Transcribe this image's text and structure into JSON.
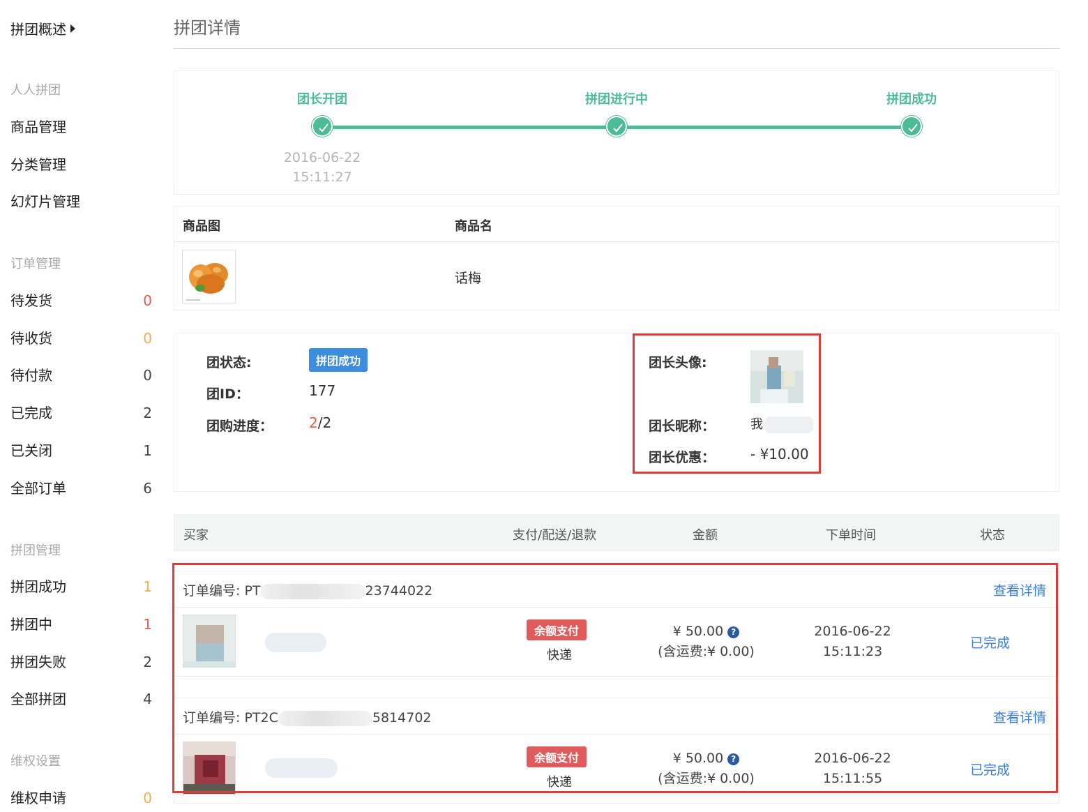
{
  "sidebar": {
    "top_link": "拼团概述",
    "sections": [
      {
        "heading": "人人拼团",
        "items": [
          {
            "label": "商品管理",
            "count": ""
          },
          {
            "label": "分类管理",
            "count": ""
          },
          {
            "label": "幻灯片管理",
            "count": ""
          }
        ]
      },
      {
        "heading": "订单管理",
        "items": [
          {
            "label": "待发货",
            "count": "0"
          },
          {
            "label": "待收货",
            "count": "0"
          },
          {
            "label": "待付款",
            "count": "0"
          },
          {
            "label": "已完成",
            "count": "2"
          },
          {
            "label": "已关闭",
            "count": "1"
          },
          {
            "label": "全部订单",
            "count": "6"
          }
        ]
      },
      {
        "heading": "拼团管理",
        "items": [
          {
            "label": "拼团成功",
            "count": "1"
          },
          {
            "label": "拼团中",
            "count": "1"
          },
          {
            "label": "拼团失败",
            "count": "2"
          },
          {
            "label": "全部拼团",
            "count": "4"
          }
        ]
      },
      {
        "heading": "维权设置",
        "items": [
          {
            "label": "维权申请",
            "count": "0"
          }
        ]
      }
    ]
  },
  "page": {
    "title": "拼团详情"
  },
  "progress": {
    "steps": [
      {
        "label": "团长开团",
        "date": "2016-06-22",
        "time": "15:11:27"
      },
      {
        "label": "拼团进行中"
      },
      {
        "label": "拼团成功"
      }
    ],
    "color": "#4cbb96"
  },
  "product": {
    "headers": {
      "image": "商品图",
      "name": "商品名"
    },
    "name": "话梅"
  },
  "group": {
    "status_label": "团状态:",
    "status_value": "拼团成功",
    "id_label": "团ID：",
    "id_value": "177",
    "progress_label": "团购进度：",
    "progress_done": "2",
    "progress_total": "/2",
    "leader_avatar_label": "团长头像:",
    "leader_nick_label": "团长昵称：",
    "leader_nick_value": "我",
    "leader_discount_label": "团长优惠：",
    "leader_discount_value": "- ¥10.00"
  },
  "orders": {
    "headers": {
      "buyer": "买家",
      "payment": "支付/配送/退款",
      "amount": "金额",
      "time": "下单时间",
      "status": "状态"
    },
    "rows": [
      {
        "no_prefix": "订单编号: PT",
        "no_suffix": "23744022",
        "detail": "查看详情",
        "pay_method": "余额支付",
        "ship": "快递",
        "amount": "¥ 50.00",
        "shipping_fee": "(含运费:¥ 0.00)",
        "date": "2016-06-22",
        "time": "15:11:23",
        "status": "已完成"
      },
      {
        "no_prefix": "订单编号: PT2C",
        "no_suffix": "5814702",
        "detail": "查看详情",
        "pay_method": "余额支付",
        "ship": "快递",
        "amount": "¥ 50.00",
        "shipping_fee": "(含运费:¥ 0.00)",
        "date": "2016-06-22",
        "time": "15:11:55",
        "status": "已完成"
      }
    ]
  },
  "icons": {
    "help": "question-circle-icon",
    "check": "check-icon",
    "caret": "caret-right-icon"
  }
}
